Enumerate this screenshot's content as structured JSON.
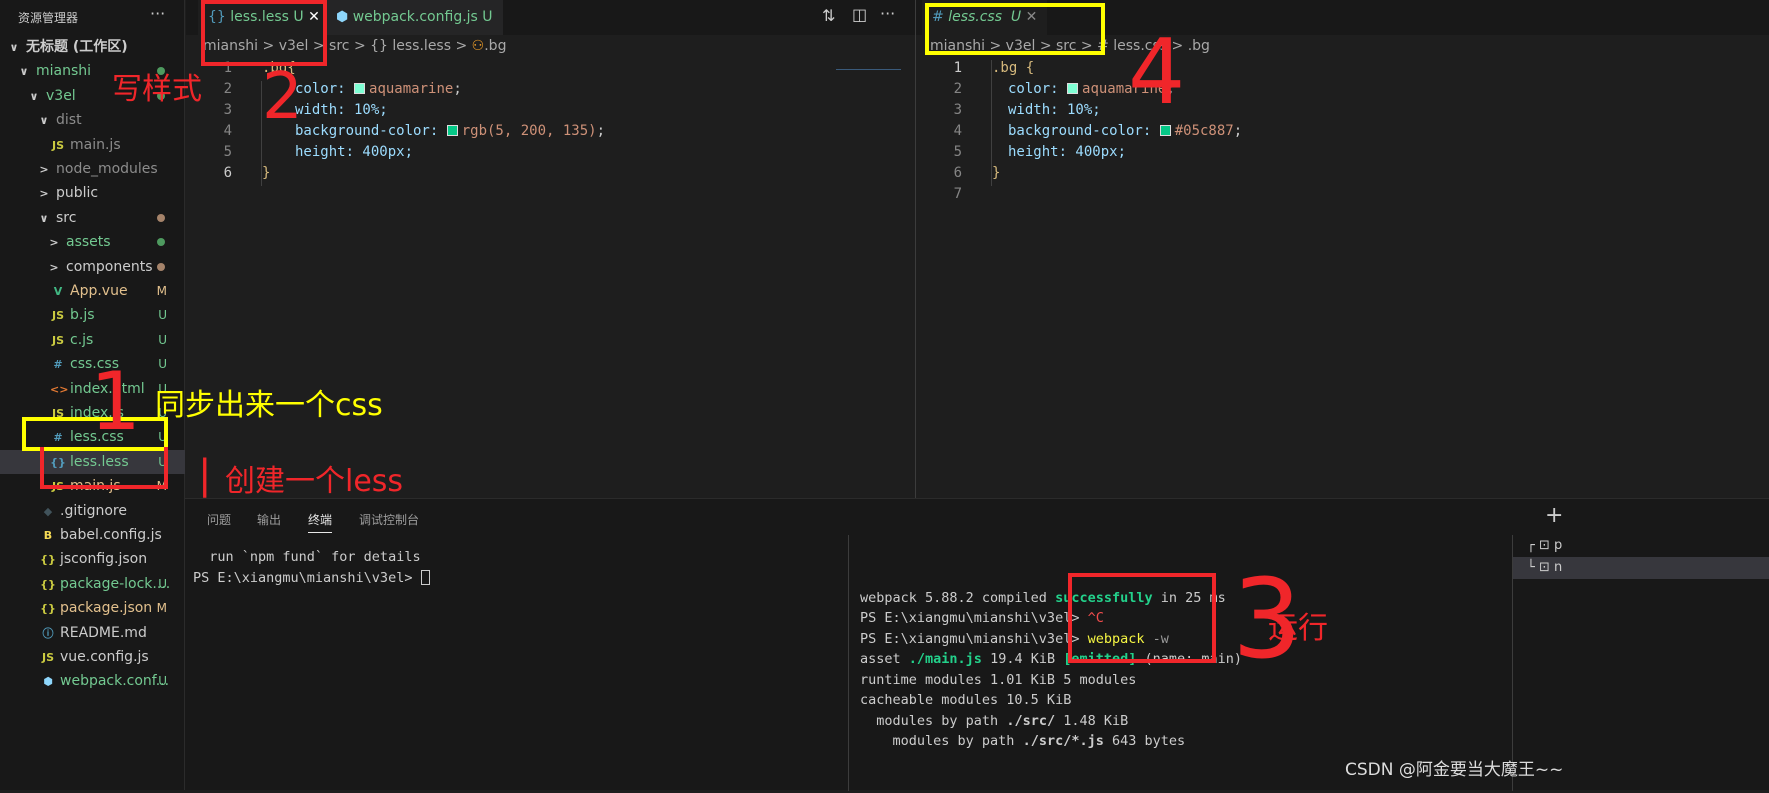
{
  "sidebar": {
    "title": "资源管理器",
    "more": "···",
    "items": [
      {
        "label": "无标题 (工作区)",
        "chev": "∨",
        "indent": 0,
        "color": "#cccccc",
        "bold": true
      },
      {
        "label": "mianshi",
        "chev": "∨",
        "indent": 1,
        "color": "#73c991",
        "dot": "#4e9a5f"
      },
      {
        "label": "v3el",
        "chev": "∨",
        "indent": 2,
        "color": "#73c991",
        "dot": "#4e9a5f"
      },
      {
        "label": "dist",
        "chev": "∨",
        "indent": 3,
        "color": "#8c8c8c"
      },
      {
        "label": "main.js",
        "icon": "JS",
        "iconColor": "#cbcb41",
        "indent": 4,
        "color": "#8c8c8c"
      },
      {
        "label": "node_modules",
        "chev": ">",
        "indent": 3,
        "color": "#8c8c8c"
      },
      {
        "label": "public",
        "chev": ">",
        "indent": 3,
        "color": "#cccccc"
      },
      {
        "label": "src",
        "chev": "∨",
        "indent": 3,
        "color": "#cccccc",
        "dot": "#a5836a"
      },
      {
        "label": "assets",
        "chev": ">",
        "indent": 4,
        "color": "#73c991",
        "dot": "#4e9a5f"
      },
      {
        "label": "components",
        "chev": ">",
        "indent": 4,
        "color": "#cccccc",
        "dot": "#a5836a"
      },
      {
        "label": "App.vue",
        "icon": "V",
        "iconColor": "#41b883",
        "indent": 4,
        "color": "#e2c08d",
        "status": "M"
      },
      {
        "label": "b.js",
        "icon": "JS",
        "iconColor": "#cbcb41",
        "indent": 4,
        "color": "#73c991",
        "status": "U"
      },
      {
        "label": "c.js",
        "icon": "JS",
        "iconColor": "#cbcb41",
        "indent": 4,
        "color": "#73c991",
        "status": "U"
      },
      {
        "label": "css.css",
        "icon": "#",
        "iconColor": "#519aba",
        "indent": 4,
        "color": "#73c991",
        "status": "U"
      },
      {
        "label": "index.html",
        "icon": "<>",
        "iconColor": "#e37933",
        "indent": 4,
        "color": "#73c991",
        "status": "U"
      },
      {
        "label": "index.js",
        "icon": "JS",
        "iconColor": "#cbcb41",
        "indent": 4,
        "color": "#73c991",
        "status": "U"
      },
      {
        "label": "less.css",
        "icon": "#",
        "iconColor": "#519aba",
        "indent": 4,
        "color": "#73c991",
        "status": "U"
      },
      {
        "label": "less.less",
        "icon": "{}",
        "iconColor": "#519aba",
        "indent": 4,
        "color": "#73c991",
        "status": "U",
        "selected": true
      },
      {
        "label": "main.js",
        "icon": "JS",
        "iconColor": "#cbcb41",
        "indent": 4,
        "color": "#e2c08d",
        "status": "M"
      },
      {
        "label": ".gitignore",
        "icon": "◆",
        "iconColor": "#41535b",
        "indent": 3,
        "color": "#cccccc"
      },
      {
        "label": "babel.config.js",
        "icon": "B",
        "iconColor": "#f5da55",
        "indent": 3,
        "color": "#cccccc"
      },
      {
        "label": "jsconfig.json",
        "icon": "{}",
        "iconColor": "#cbcb41",
        "indent": 3,
        "color": "#cccccc"
      },
      {
        "label": "package-lock....",
        "icon": "{}",
        "iconColor": "#cbcb41",
        "indent": 3,
        "color": "#73c991",
        "status": "U"
      },
      {
        "label": "package.json",
        "icon": "{}",
        "iconColor": "#cbcb41",
        "indent": 3,
        "color": "#e2c08d",
        "status": "M"
      },
      {
        "label": "README.md",
        "icon": "ⓘ",
        "iconColor": "#519aba",
        "indent": 3,
        "color": "#cccccc"
      },
      {
        "label": "vue.config.js",
        "icon": "JS",
        "iconColor": "#cbcb41",
        "indent": 3,
        "color": "#cccccc"
      },
      {
        "label": "webpack.conf...",
        "icon": "⬢",
        "iconColor": "#8ed6fb",
        "indent": 3,
        "color": "#73c991",
        "status": "U"
      }
    ]
  },
  "left_editor": {
    "tabs": [
      {
        "label": "less.less",
        "status": "U",
        "close": "✕",
        "icon": "{}"
      },
      {
        "label": "webpack.config.js",
        "status": "U",
        "icon": "⬢"
      }
    ],
    "breadcrumb": [
      "mianshi",
      ">",
      "v3el",
      ">",
      "src",
      ">",
      "{} less.less",
      ">",
      ".bg"
    ],
    "lines": [
      "1",
      "2",
      "3",
      "4",
      "5",
      "6"
    ],
    "code": {
      "l1": ".bg{",
      "l2_prop": "color: ",
      "l2_val": "aquamarine",
      "l3": "width: 10%;",
      "l4_prop": "background-color: ",
      "l4_val": "rgb(5, 200, 135)",
      "l5": "height: 400px;",
      "l6": "}"
    }
  },
  "right_editor": {
    "tabs": [
      {
        "label": "less.css",
        "status": "U",
        "close": "✕",
        "icon": "#"
      }
    ],
    "breadcrumb": "mianshi > v3el > src > # less.css > .bg",
    "lines": [
      "1",
      "2",
      "3",
      "4",
      "5",
      "6",
      "7"
    ],
    "code": {
      "l1": ".bg {",
      "l2_prop": "color: ",
      "l2_val": "aquamarine",
      "l3": "width: 10%;",
      "l4_prop": "background-color: ",
      "l4_val": "#05c887",
      "l5": "height: 400px;",
      "l6": "}"
    }
  },
  "panel": {
    "tabs": [
      "问题",
      "输出",
      "终端",
      "调试控制台"
    ],
    "add": "+",
    "term_left": [
      "  run `npm fund` for details",
      "PS E:\\xiangmu\\mianshi\\v3el> "
    ],
    "term_right": {
      "l1a": "webpack 5.88.2 compiled ",
      "l1b": "successfully",
      "l1c": " in 25 ms",
      "l2a": "PS E:\\xiangmu\\mianshi\\v3el> ",
      "l2b": "^C",
      "l3a": "PS E:\\xiangmu\\mianshi\\v3el> ",
      "l3b": "webpack",
      "l3c": " -w",
      "l4a": "asset ",
      "l4b": "./main.js",
      "l4c": " 19.4 KiB ",
      "l4d": "[emitted]",
      "l4e": " (name: main)",
      "l5": "runtime modules 1.01 KiB 5 modules",
      "l6": "cacheable modules 10.5 KiB",
      "l7a": "  modules by path ",
      "l7b": "./src/",
      "l7c": " 1.48 KiB",
      "l8a": "    modules by path ",
      "l8b": "./src/*.js",
      "l8c": " 643 bytes"
    },
    "term_list": [
      "p",
      "n"
    ]
  },
  "annotations": {
    "write_style": "写样式",
    "n2": "2",
    "sync_css": "同步出来一个css",
    "n1": "1",
    "create_less": "创建一个less",
    "n4": "4",
    "run": "运行",
    "n3": "3"
  },
  "watermark": "CSDN @阿金要当大魔王~~",
  "colors": {
    "accent_red": "#f0262a",
    "accent_yellow": "#ffff00",
    "aquamarine": "#7fffd4",
    "bg_green": "#05c887"
  }
}
